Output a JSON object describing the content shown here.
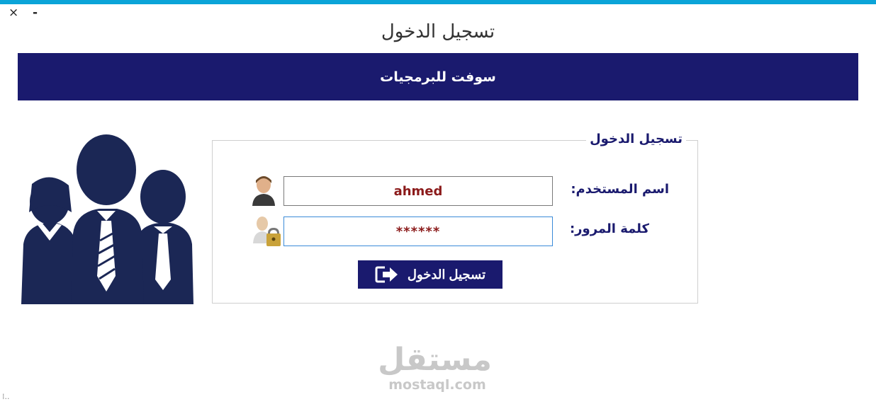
{
  "window": {
    "title": "تسجيل الدخول",
    "close_glyph": "×",
    "minimize_glyph": "-",
    "accent_color": "#0ba4d8"
  },
  "banner": {
    "text": "سوفت للبرمجيات",
    "background": "#1a1a6e"
  },
  "login_group": {
    "legend": "تسجيل الدخول",
    "username_label": "اسم المستخدم:",
    "username_value": "ahmed",
    "password_label": "كلمة المرور:",
    "password_value": "******",
    "submit_label": "تسجيل الدخول"
  },
  "icons": {
    "users": "users-group-icon",
    "user": "user-icon",
    "lock": "user-lock-icon",
    "login": "login-arrow-icon"
  },
  "watermark": {
    "logo_text": "مستقل",
    "url": "mostaql.com"
  },
  "status": {
    "grip": "⁞.."
  }
}
